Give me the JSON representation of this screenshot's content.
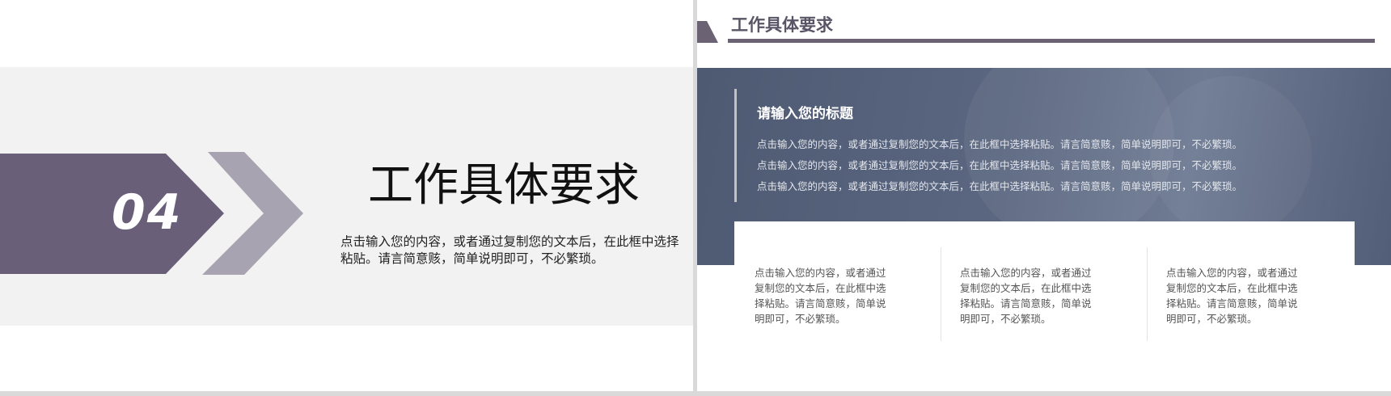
{
  "left_slide": {
    "section_number": "04",
    "title": "工作具体要求",
    "description": "点击输入您的内容，或者通过复制您的文本后，在此框中选择粘贴。请言简意赅，简单说明即可，不必繁琐。",
    "colors": {
      "arrow_dark": "#6a5f78",
      "arrow_light": "#a7a3b0",
      "band": "#f2f2f2"
    }
  },
  "right_slide": {
    "title": "工作具体要求",
    "hero": {
      "heading": "请输入您的标题",
      "lines": [
        "点击输入您的内容，或者通过复制您的文本后，在此框中选择粘贴。请言简意赅，简单说明即可，不必繁琐。",
        "点击输入您的内容，或者通过复制您的文本后，在此框中选择粘贴。请言简意赅，简单说明即可，不必繁琐。",
        "点击输入您的内容，或者通过复制您的文本后，在此框中选择粘贴。请言简意赅，简单说明即可，不必繁琐。"
      ]
    },
    "columns": [
      "点击输入您的内容，或者通过复制您的文本后，在此框中选择粘贴。请言简意赅，简单说明即可，不必繁琐。",
      "点击输入您的内容，或者通过复制您的文本后，在此框中选择粘贴。请言简意赅，简单说明即可，不必繁琐。",
      "点击输入您的内容，或者通过复制您的文本后，在此框中选择粘贴。请言简意赅，简单说明即可，不必繁琐。"
    ],
    "colors": {
      "accent": "#6b6274",
      "hero_bg": "#56627b"
    }
  }
}
